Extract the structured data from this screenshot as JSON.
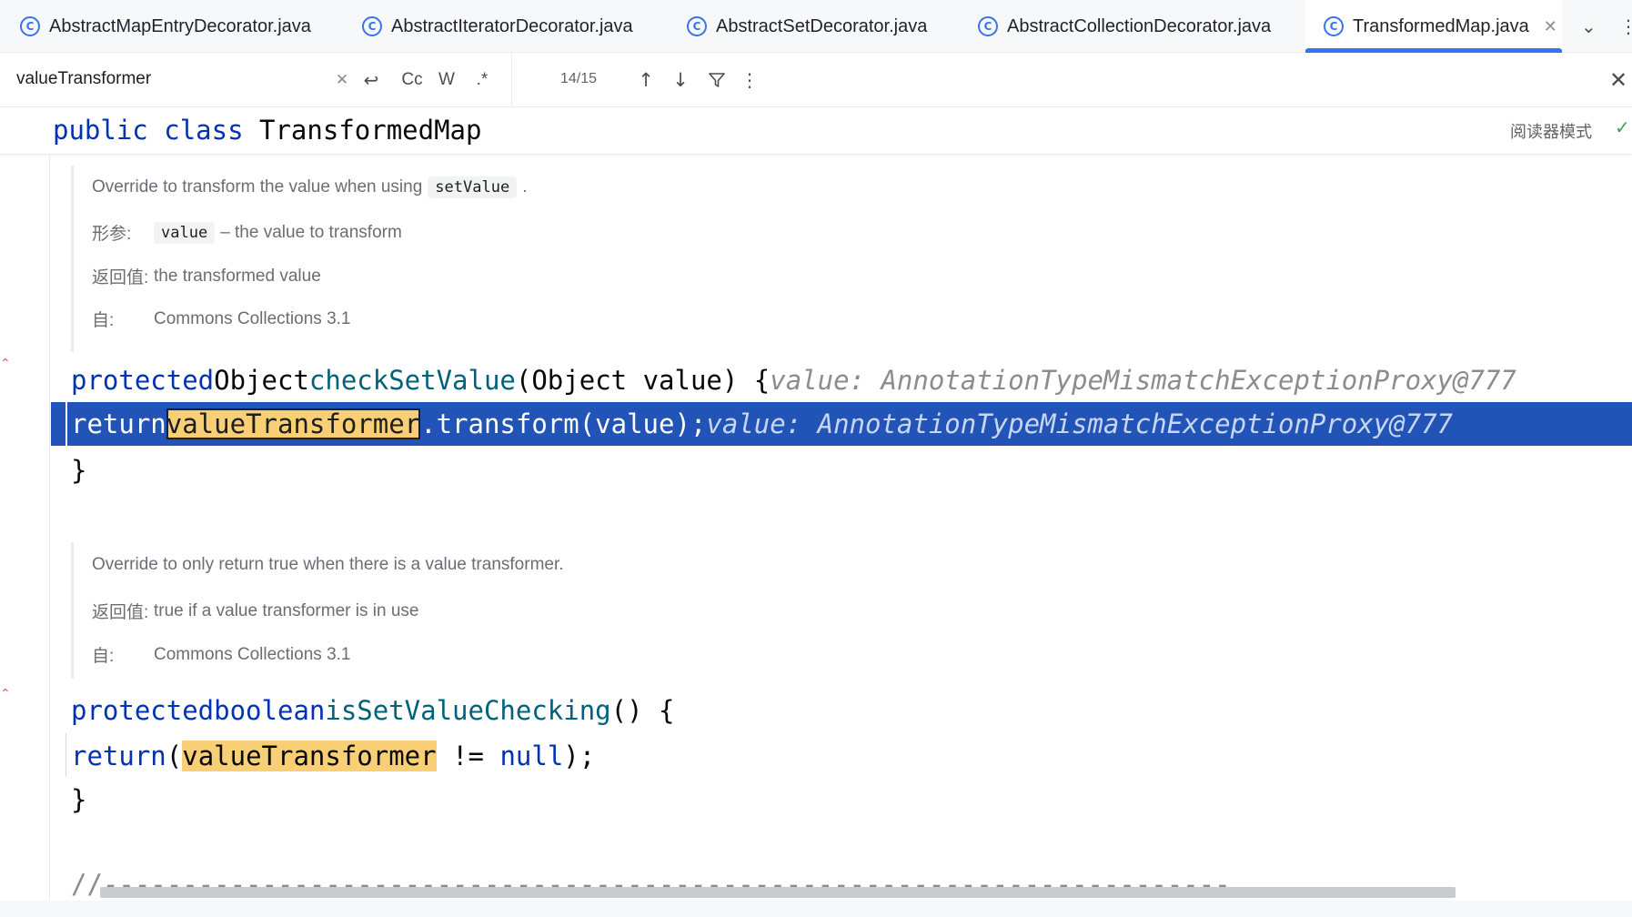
{
  "tabs": [
    {
      "label": "AbstractMapEntryDecorator.java",
      "icon": "class-icon",
      "active": false
    },
    {
      "label": "AbstractIteratorDecorator.java",
      "icon": "class-icon",
      "active": false
    },
    {
      "label": "AbstractSetDecorator.java",
      "icon": "class-icon",
      "active": false
    },
    {
      "label": "AbstractCollectionDecorator.java",
      "icon": "class-icon",
      "active": false
    },
    {
      "label": "TransformedMap.java",
      "icon": "class-icon",
      "active": true
    }
  ],
  "search": {
    "value": "valueTransformer",
    "match_case_label": "Cc",
    "words_label": "W",
    "regex_label": ".*",
    "match_count": "14/15"
  },
  "sticky": {
    "kw1": "public",
    "kw2": "class",
    "name": "TransformedMap",
    "reader_mode": "阅读器模式"
  },
  "doc1": {
    "line1_text": "Override to transform the value when using",
    "line1_code": "setValue",
    "line1_end": ".",
    "param_tag": "形参:",
    "param_code": "value",
    "param_desc": "– the value to transform",
    "return_tag": "返回值:",
    "return_desc": "the transformed value",
    "since_tag": "自:",
    "since_desc": "Commons Collections 3.1"
  },
  "code1": {
    "line1_kw": "protected",
    "line1_type": "Object",
    "line1_fn": "checkSetValue",
    "line1_rest": "(Object value) {",
    "line1_hint": "value: AnnotationTypeMismatchExceptionProxy@777",
    "line2_kw": "return",
    "line2_match": "valueTransformer",
    "line2_rest": ".transform(value);",
    "line2_hint": "value: AnnotationTypeMismatchExceptionProxy@777",
    "line3": "}"
  },
  "doc2": {
    "line1_text": "Override to only return true when there is a value transformer.",
    "return_tag": "返回值:",
    "return_desc": "true if a value transformer is in use",
    "since_tag": "自:",
    "since_desc": "Commons Collections 3.1"
  },
  "code2": {
    "line1_kw": "protected",
    "line1_type": "boolean",
    "line1_fn": "isSetValueChecking",
    "line1_rest": "() {",
    "line2_kw": "return",
    "line2_open": "(",
    "line2_match": "valueTransformer",
    "line2_op": " != ",
    "line2_null": "null",
    "line2_close": ");",
    "line3": "}"
  },
  "separator": "//-----------------------------------------------------------------------",
  "colors": {
    "keyword": "#0033b3",
    "function": "#00627a",
    "exec_line": "#2154b6",
    "match_highlight": "#f9cf75",
    "active_tab_underline": "#3574f0"
  }
}
